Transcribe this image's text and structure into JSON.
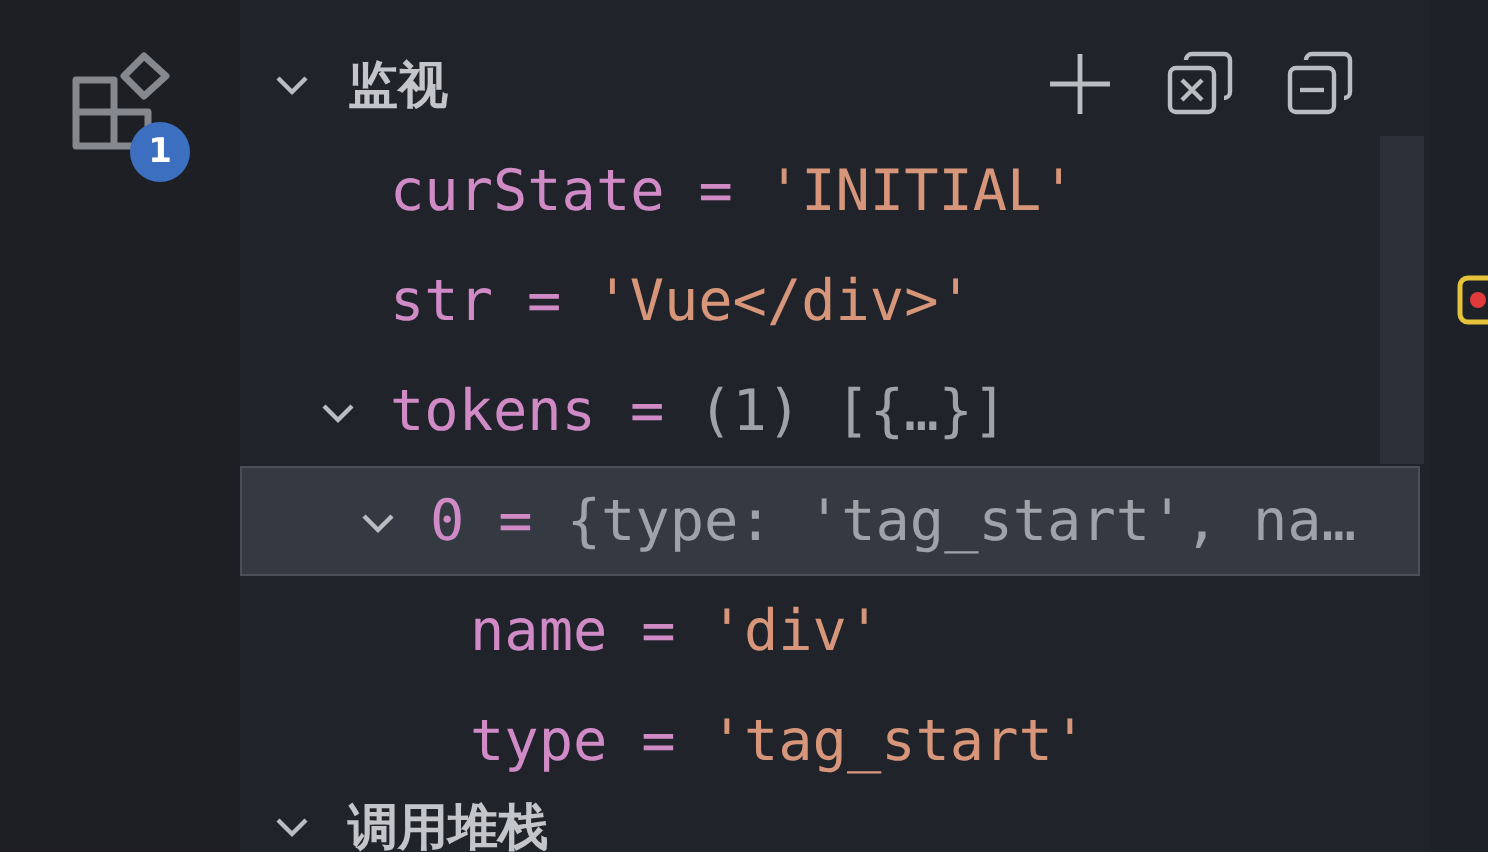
{
  "activity_bar": {
    "badge": "1"
  },
  "watch": {
    "title": "监视",
    "expanded": true,
    "rows": [
      {
        "name": "curState",
        "separator": "=",
        "value": "'INITIAL'",
        "kind": "string",
        "selected": false
      },
      {
        "name": "str",
        "separator": "=",
        "value": "'Vue</div>'",
        "kind": "string",
        "selected": false
      },
      {
        "name": "tokens",
        "separator": "=",
        "value": "(1) [{…}]",
        "kind": "object",
        "selected": false,
        "expanded": true,
        "children": [
          {
            "name": "0",
            "separator": "=",
            "value": "{type: 'tag_start', na…",
            "kind": "object",
            "selected": true,
            "expanded": true,
            "children": [
              {
                "name": "name",
                "separator": "=",
                "value": "'div'",
                "kind": "string",
                "selected": false
              },
              {
                "name": "type",
                "separator": "=",
                "value": "'tag_start'",
                "kind": "string",
                "selected": false
              }
            ]
          }
        ]
      }
    ]
  },
  "call_stack": {
    "title": "调用堆栈",
    "expanded": true
  }
}
